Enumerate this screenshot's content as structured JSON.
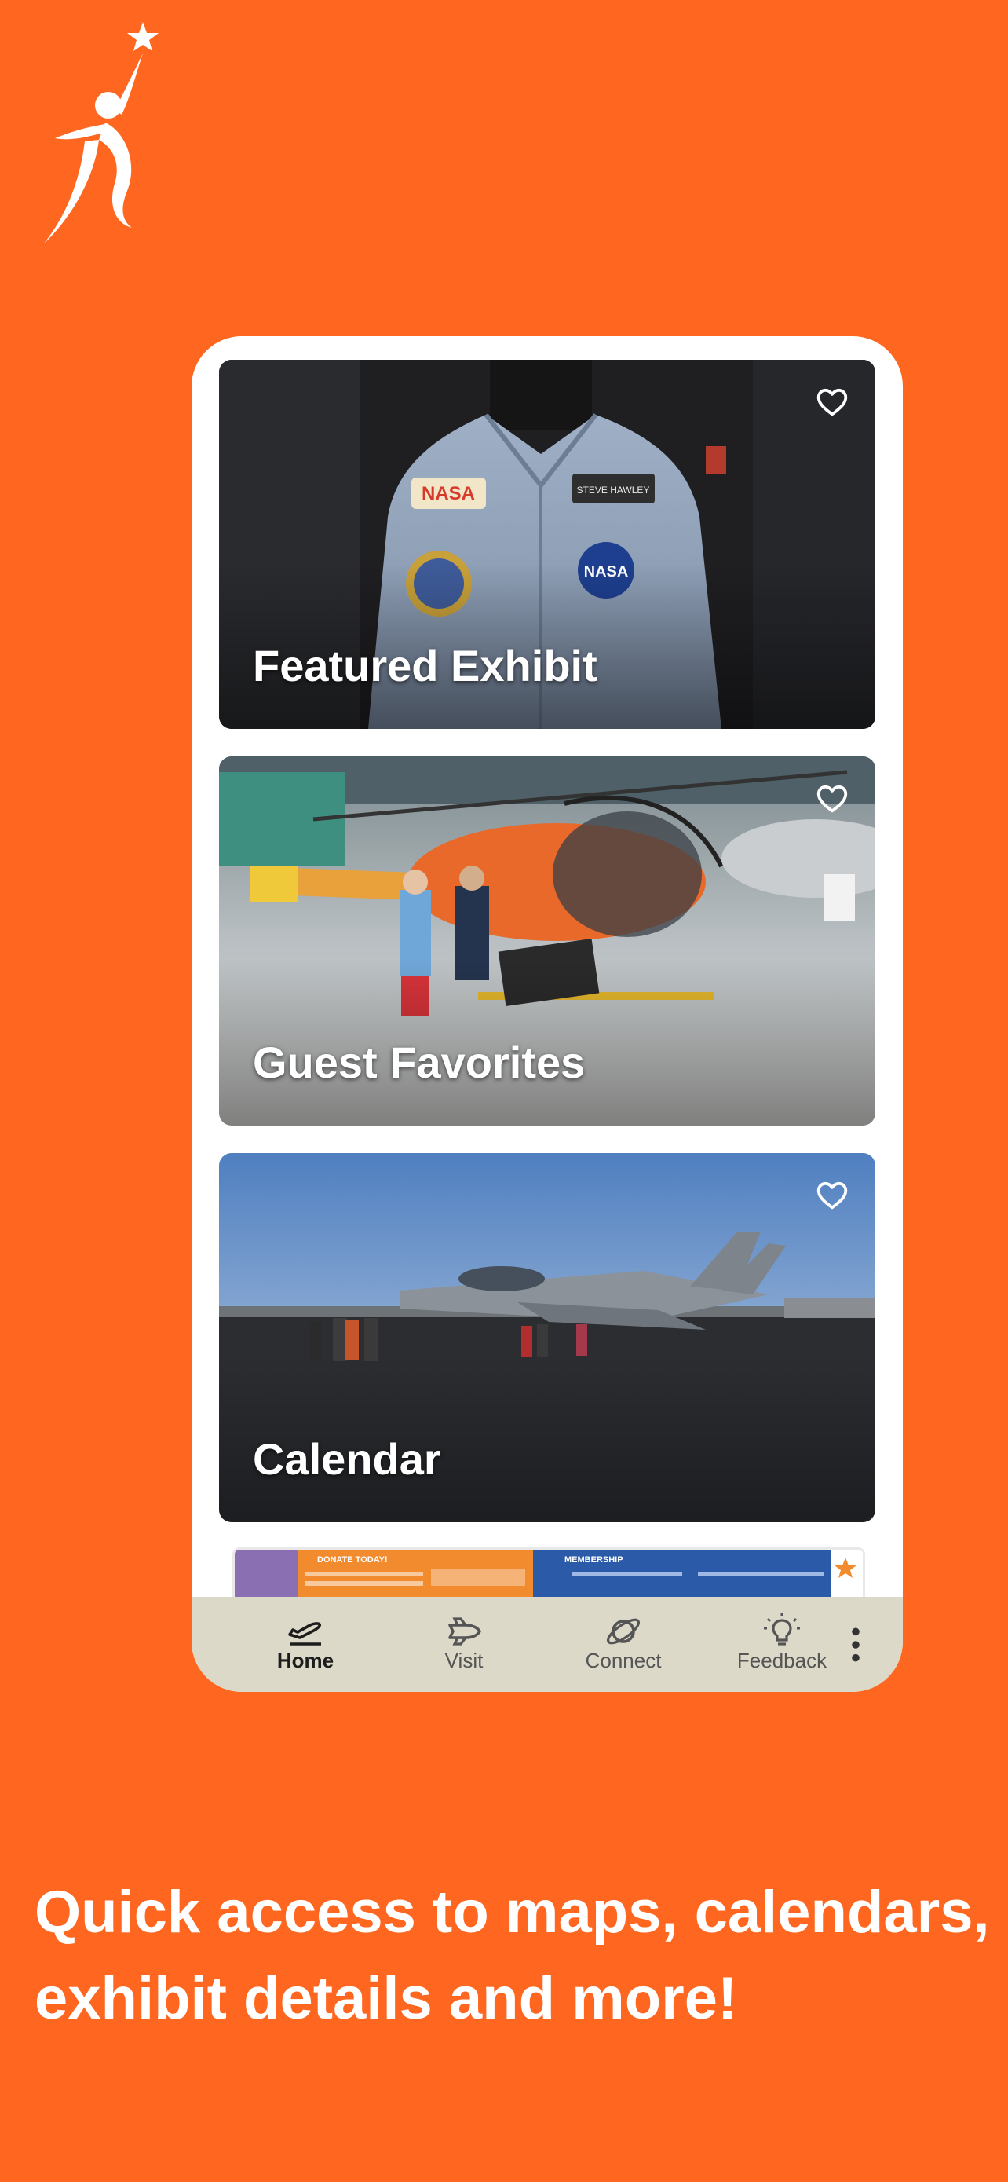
{
  "colors": {
    "background": "#FF6720",
    "phone_frame": "#FFFFFF",
    "bottom_nav": "#DDD9C9",
    "card_title": "#FFFFFF"
  },
  "logo": {
    "icon": "star-figure-icon"
  },
  "cards": [
    {
      "title": "Featured Exhibit",
      "icon": "heart-outline-icon",
      "image": "nasa-flight-jacket-photo"
    },
    {
      "title": "Guest Favorites",
      "icon": "heart-outline-icon",
      "image": "helicopter-hangar-photo"
    },
    {
      "title": "Calendar",
      "icon": "heart-outline-icon",
      "image": "jet-on-tarmac-photo"
    }
  ],
  "banner": {
    "donate_label": "DONATE TODAY!",
    "membership_label": "MEMBERSHIP"
  },
  "bottom_nav": {
    "items": [
      {
        "label": "Home",
        "icon": "plane-takeoff-icon",
        "active": true
      },
      {
        "label": "Visit",
        "icon": "shuttle-icon",
        "active": false
      },
      {
        "label": "Connect",
        "icon": "planet-icon",
        "active": false
      },
      {
        "label": "Feedback",
        "icon": "lightbulb-icon",
        "active": false
      }
    ],
    "more_icon": "more-vertical-icon"
  },
  "tagline": {
    "line1": "Quick access to maps, calendars,",
    "line2": "exhibit details and more!"
  }
}
